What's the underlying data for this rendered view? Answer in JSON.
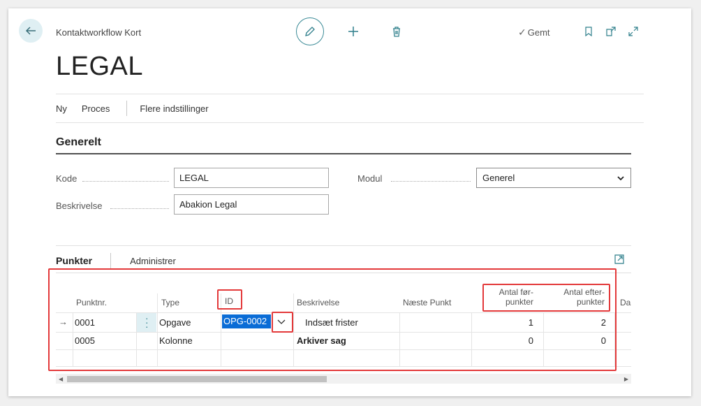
{
  "header": {
    "breadcrumb": "Kontaktworkflow Kort",
    "saved_label": "Gemt",
    "title": "LEGAL"
  },
  "action_bar": {
    "items": [
      "Ny",
      "Proces",
      "Flere indstillinger"
    ]
  },
  "general": {
    "section_title": "Generelt",
    "kode_label": "Kode",
    "kode_value": "LEGAL",
    "beskrivelse_label": "Beskrivelse",
    "beskrivelse_value": "Abakion Legal",
    "modul_label": "Modul",
    "modul_value": "Generel"
  },
  "lines": {
    "tab_active": "Punkter",
    "tab_manage": "Administrer",
    "columns": {
      "punktnr": "Punktnr.",
      "type": "Type",
      "id": "ID",
      "beskrivelse": "Beskrivelse",
      "naeste": "Næste Punkt",
      "antal_foer_1": "Antal før-",
      "antal_foer_2": "punkter",
      "antal_efter_1": "Antal efter-",
      "antal_efter_2": "punkter",
      "dato": "Da"
    },
    "rows": [
      {
        "punktnr": "0001",
        "type": "Opgave",
        "id": "OPG-0002",
        "beskrivelse": "Indsæt frister",
        "naeste": "",
        "antal_foer": "1",
        "antal_efter": "2"
      },
      {
        "punktnr": "0005",
        "type": "Kolonne",
        "id": "",
        "beskrivelse": "Arkiver sag",
        "naeste": "",
        "antal_foer": "0",
        "antal_efter": "0"
      }
    ]
  },
  "colors": {
    "accent": "#3a8a96",
    "highlight": "#e3393a",
    "selection": "#0a6cd6"
  }
}
